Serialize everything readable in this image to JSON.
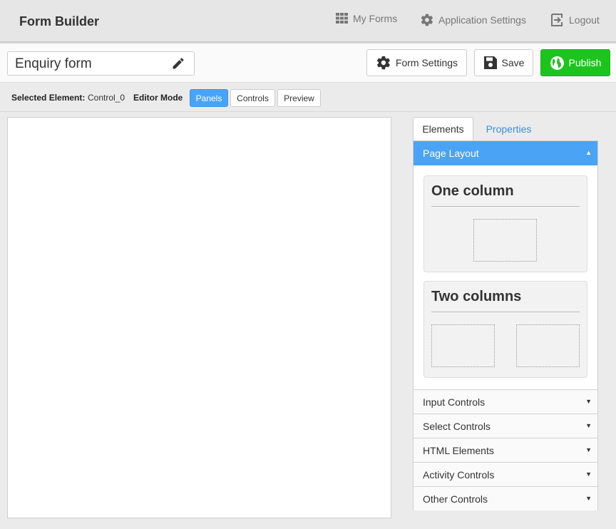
{
  "app": {
    "title": "Form Builder"
  },
  "nav": {
    "my_forms": "My Forms",
    "application_settings": "Application Settings",
    "logout": "Logout"
  },
  "toolbar": {
    "form_name": "Enquiry form",
    "form_settings": "Form Settings",
    "save": "Save",
    "publish": "Publish"
  },
  "modebar": {
    "selected_label": "Selected Element:",
    "selected_value": "Control_0",
    "mode_label": "Editor Mode",
    "modes": [
      "Panels",
      "Controls",
      "Preview"
    ],
    "active_mode": "Panels"
  },
  "sidepanel": {
    "tabs": [
      "Elements",
      "Properties"
    ],
    "active_tab": "Elements",
    "open_section": {
      "label": "Page Layout",
      "arrow": "▲",
      "layouts": [
        "One column",
        "Two columns"
      ]
    },
    "sections": [
      {
        "label": "Input Controls",
        "arrow": "▼"
      },
      {
        "label": "Select Controls",
        "arrow": "▼"
      },
      {
        "label": "HTML Elements",
        "arrow": "▼"
      },
      {
        "label": "Activity Controls",
        "arrow": "▼"
      },
      {
        "label": "Other Controls",
        "arrow": "▼"
      }
    ]
  },
  "colors": {
    "accent": "#4aa3f5",
    "publish": "#1ec41e",
    "link": "#3a8fd6"
  }
}
